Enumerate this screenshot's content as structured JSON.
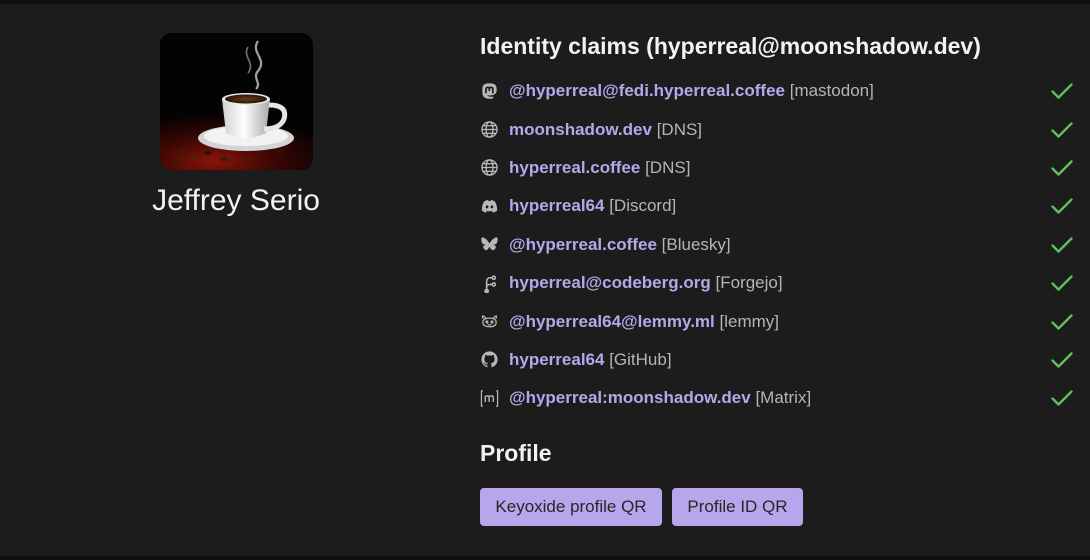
{
  "profile": {
    "display_name": "Jeffrey Serio"
  },
  "claims": {
    "title": "Identity claims (hyperreal@moonshadow.dev)",
    "items": [
      {
        "icon": "mastodon-icon",
        "id": "@hyperreal@fedi.hyperreal.coffee",
        "service": "[mastodon]",
        "verified": true
      },
      {
        "icon": "globe-icon",
        "id": "moonshadow.dev",
        "service": "[DNS]",
        "verified": true
      },
      {
        "icon": "globe-icon",
        "id": "hyperreal.coffee",
        "service": "[DNS]",
        "verified": true
      },
      {
        "icon": "discord-icon",
        "id": "hyperreal64",
        "service": "[Discord]",
        "verified": true
      },
      {
        "icon": "bluesky-icon",
        "id": "@hyperreal.coffee",
        "service": "[Bluesky]",
        "verified": true
      },
      {
        "icon": "forgejo-icon",
        "id": "hyperreal@codeberg.org",
        "service": "[Forgejo]",
        "verified": true
      },
      {
        "icon": "lemmy-icon",
        "id": "@hyperreal64@lemmy.ml",
        "service": "[lemmy]",
        "verified": true
      },
      {
        "icon": "github-icon",
        "id": "hyperreal64",
        "service": "[GitHub]",
        "verified": true
      },
      {
        "icon": "matrix-icon",
        "id": "@hyperreal:moonshadow.dev",
        "service": "[Matrix]",
        "verified": true
      }
    ]
  },
  "profile_section": {
    "title": "Profile",
    "keyoxide_qr_label": "Keyoxide profile QR",
    "profile_id_qr_label": "Profile ID QR"
  },
  "colors": {
    "background": "#1c1c1c",
    "accent": "#b8a6ec",
    "check": "#5fbf5a"
  }
}
